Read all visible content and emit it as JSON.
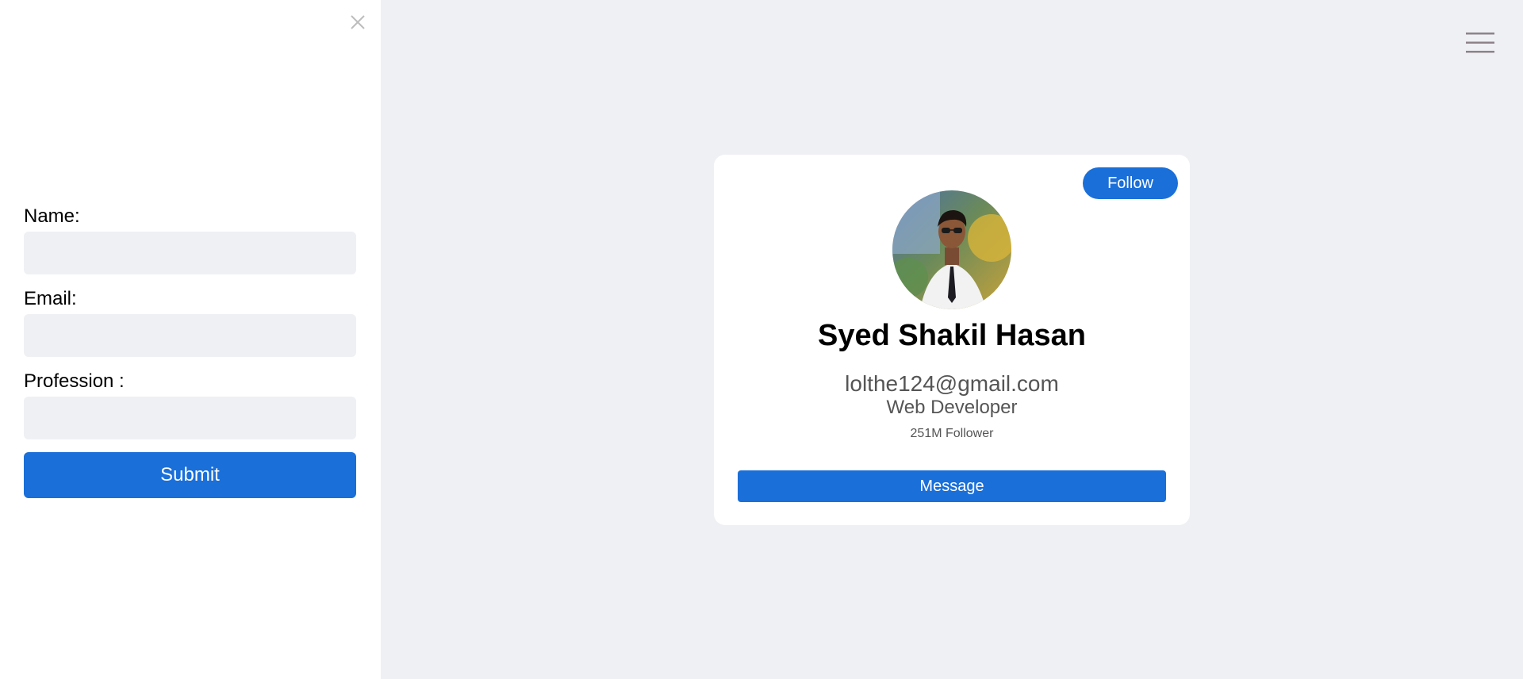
{
  "sidebar": {
    "close_icon": "close-icon",
    "form": {
      "name_label": "Name:",
      "name_value": "",
      "email_label": "Email:",
      "email_value": "",
      "profession_label": "Profession :",
      "profession_value": "",
      "submit_label": "Submit"
    }
  },
  "header": {
    "menu_icon": "hamburger-menu-icon"
  },
  "profile_card": {
    "follow_label": "Follow",
    "name": "Syed Shakil Hasan",
    "email": "lolthe124@gmail.com",
    "profession": "Web Developer",
    "followers": "251M Follower",
    "message_label": "Message"
  },
  "colors": {
    "accent": "#1a6fd9",
    "page_background": "#eff0f4",
    "panel_background": "#ffffff"
  }
}
